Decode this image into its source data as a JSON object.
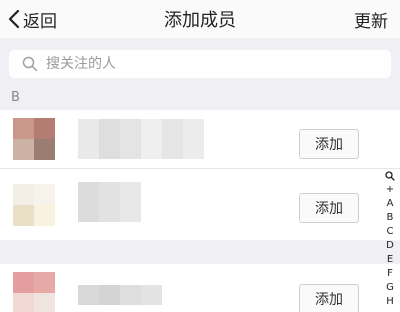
{
  "nav": {
    "back_label": "返回",
    "title": "添加成员",
    "right_label": "更新"
  },
  "search": {
    "placeholder": "搜关注的人"
  },
  "sections": {
    "b": "B",
    "f": ""
  },
  "contacts": [
    {
      "add_label": "添加",
      "avatar_colors": [
        "#c9988a",
        "#b47d74",
        "#cbb2a4",
        "#9b7d72"
      ],
      "name_colors": [
        "#e9e9e9",
        "#dedede",
        "#e4e4e4",
        "#efefef",
        "#e6e6e6",
        "#ececec"
      ]
    },
    {
      "add_label": "添加",
      "avatar_colors": [
        "#f4efe6",
        "#f6f3ed",
        "#eae0c8",
        "#f8f2e1"
      ],
      "name_colors": [
        "#dcdcdc",
        "#e2e2e2",
        "#e8e8e8"
      ]
    },
    {
      "add_label": "添加",
      "avatar_colors": [
        "#e39e9d",
        "#e6a9a6",
        "#f2d9d5",
        "#efe4df"
      ],
      "name_colors": [
        "#d9d9d9",
        "#d4d4d4",
        "#dedede",
        "#e3e3e3"
      ]
    }
  ],
  "index_letters": [
    "+",
    "A",
    "B",
    "C",
    "D",
    "E",
    "F",
    "G",
    "H"
  ],
  "colors": {
    "background": "#efeff4",
    "nav": "#fafafa",
    "button_border": "#cfcfcf"
  }
}
